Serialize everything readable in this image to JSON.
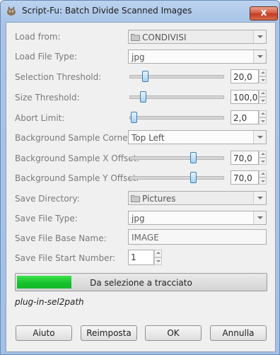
{
  "window": {
    "title": "Script-Fu: Batch Divide Scanned Images",
    "close_label": "x"
  },
  "form": {
    "load_from": {
      "label": "Load from:",
      "value": "CONDIVISI",
      "icon": "folder-icon"
    },
    "load_file_type": {
      "label": "Load File Type:",
      "value": "jpg"
    },
    "selection_threshold": {
      "label": "Selection Threshold:",
      "value": "20,0",
      "level": 0.15
    },
    "size_threshold": {
      "label": "Size Threshold:",
      "value": "100,0",
      "level": 0.12
    },
    "abort_limit": {
      "label": "Abort Limit:",
      "value": "2,0",
      "level": 0.02
    },
    "background_sample_corner": {
      "label": "Background Sample Corner:",
      "value": "Top Left"
    },
    "background_sample_x_offset": {
      "label": "Background Sample X Offset:",
      "value": "70,0",
      "level": 0.7
    },
    "background_sample_y_offset": {
      "label": "Background Sample Y Offset:",
      "value": "70,0",
      "level": 0.7
    },
    "save_directory": {
      "label": "Save Directory:",
      "value": "Pictures",
      "icon": "folder-icon"
    },
    "save_file_type": {
      "label": "Save File Type:",
      "value": "jpg"
    },
    "save_file_base_name": {
      "label": "Save File Base Name:",
      "value": "IMAGE"
    },
    "save_file_start_number": {
      "label": "Save File Start Number:",
      "value": "1"
    }
  },
  "progress": {
    "text": "Da selezione a tracciato",
    "fraction": 0.22
  },
  "procedure_name": "plug-in-sel2path",
  "buttons": {
    "help": "Aiuto",
    "reset": "Reimposta",
    "ok": "OK",
    "cancel": "Annulla"
  },
  "colors": {
    "progress_fill": "#14c02a",
    "window_frame": "#a9c4e8",
    "close_button": "#d2553a"
  }
}
